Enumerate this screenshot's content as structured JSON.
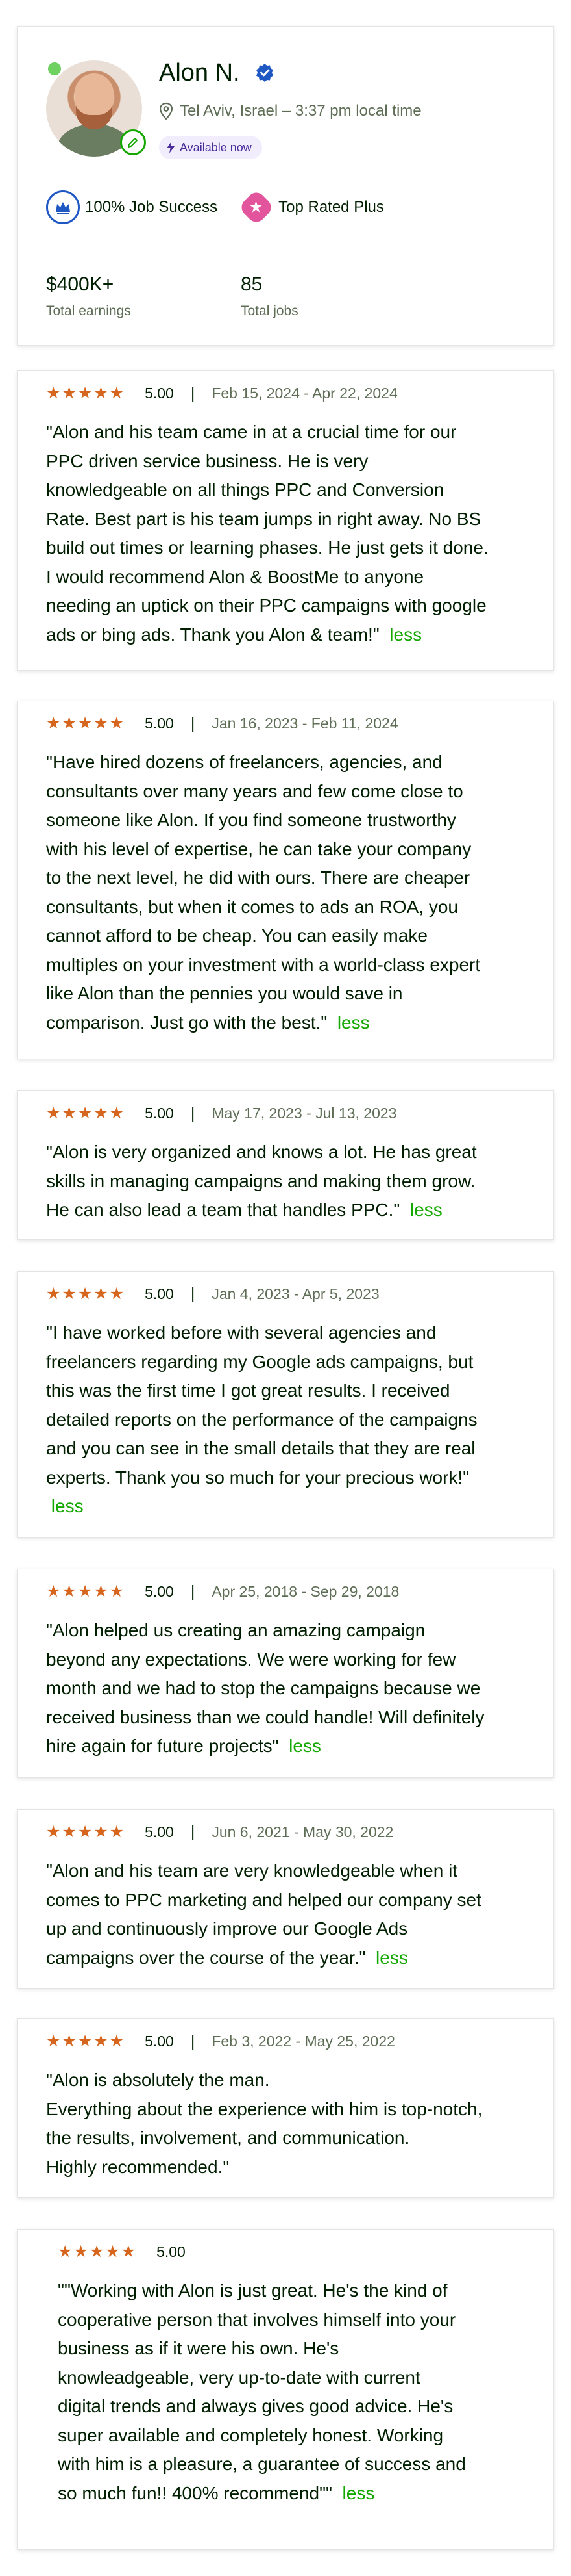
{
  "profile": {
    "name": "Alon N.",
    "location": "Tel Aviv, Israel – 3:37 pm local time",
    "availability": "Available now",
    "job_success": "100% Job Success",
    "top_rated": "Top Rated Plus",
    "total_earnings_value": "$400K+",
    "total_earnings_label": "Total earnings",
    "total_jobs_value": "85",
    "total_jobs_label": "Total jobs",
    "colors": {
      "online": "#6fd160",
      "verified": "#1f57c3",
      "accent": "#14a800",
      "star": "#d6651d"
    }
  },
  "reviews": [
    {
      "stars": "★★★★★",
      "score": "5.00",
      "dates": "Feb 15, 2024 - Apr 22, 2024",
      "text": "\"Alon and his team came in at a crucial time for our\nPPC driven service business. He is very\nknowledgeable on all things PPC and Conversion\nRate. Best part is his team jumps in right away. No BS\nbuild out times or learning phases. He just gets it done.\nI would recommend Alon & BoostMe to anyone\nneeding an uptick on their PPC campaigns with google\nads or bing ads. Thank you Alon & team!\"",
      "less": "less"
    },
    {
      "stars": "★★★★★",
      "score": "5.00",
      "dates": "Jan 16, 2023 - Feb 11, 2024",
      "text": "\"Have hired dozens of freelancers, agencies, and\nconsultants over many years and few come close to\nsomeone like Alon. If you find someone trustworthy\nwith his level of expertise, he can take your company\nto the next level, he did with ours. There are cheaper\nconsultants, but when it comes to ads an ROA, you\ncannot afford to be cheap. You can easily make\nmultiples on your investment with a world-class expert\nlike Alon than the pennies you would save in\ncomparison. Just go with the best.\"",
      "less": "less"
    },
    {
      "stars": "★★★★★",
      "score": "5.00",
      "dates": "May 17, 2023 - Jul 13, 2023",
      "text": "\"Alon is very organized and knows a lot. He has great\nskills in managing campaigns and making them grow.\nHe can also lead a team that handles PPC.\"",
      "less": "less"
    },
    {
      "stars": "★★★★★",
      "score": "5.00",
      "dates": "Jan 4, 2023 - Apr 5, 2023",
      "text": "\"I have worked before with several agencies and\nfreelancers regarding my Google ads campaigns, but\nthis was the first time I got great results. I received\ndetailed reports on the performance of the campaigns\nand you can see in the small details that they are real\nexperts. Thank you so much for your precious work!\"\n",
      "less": "less"
    },
    {
      "stars": "★★★★★",
      "score": "5.00",
      "dates": "Apr 25, 2018 - Sep 29, 2018",
      "text": "\"Alon helped us creating an amazing campaign\nbeyond any expectations. We were working for few\nmonth and we had to stop the campaigns because we\nreceived business than we could handle! Will definitely\nhire again for future projects\"",
      "less": "less"
    },
    {
      "stars": "★★★★★",
      "score": "5.00",
      "dates": "Jun 6, 2021 - May 30, 2022",
      "text": "\"Alon and his team are very knowledgeable when it\ncomes to PPC marketing and helped our company set\nup and continuously improve our Google Ads\ncampaigns over the course of the year.\"",
      "less": "less"
    },
    {
      "stars": "★★★★★",
      "score": "5.00",
      "dates": "Feb 3, 2022 - May 25, 2022",
      "text": "\"Alon is absolutely the man.\nEverything about the experience with him is top-notch,\nthe results, involvement, and communication.\nHighly recommended.\"",
      "less": ""
    },
    {
      "stars": "★★★★★",
      "score": "5.00",
      "dates": "",
      "text": "\"\"Working with Alon is just great. He's the kind of\ncooperative person that involves himself into your\nbusiness as if it were his own. He's\nknowleadgeable, very up-to-date with current\ndigital trends and always gives good advice. He's\nsuper available and completely honest. Working\nwith him is a pleasure, a guarantee of success and\nso much fun!! 400% recommend\"\"",
      "less": "less"
    }
  ]
}
